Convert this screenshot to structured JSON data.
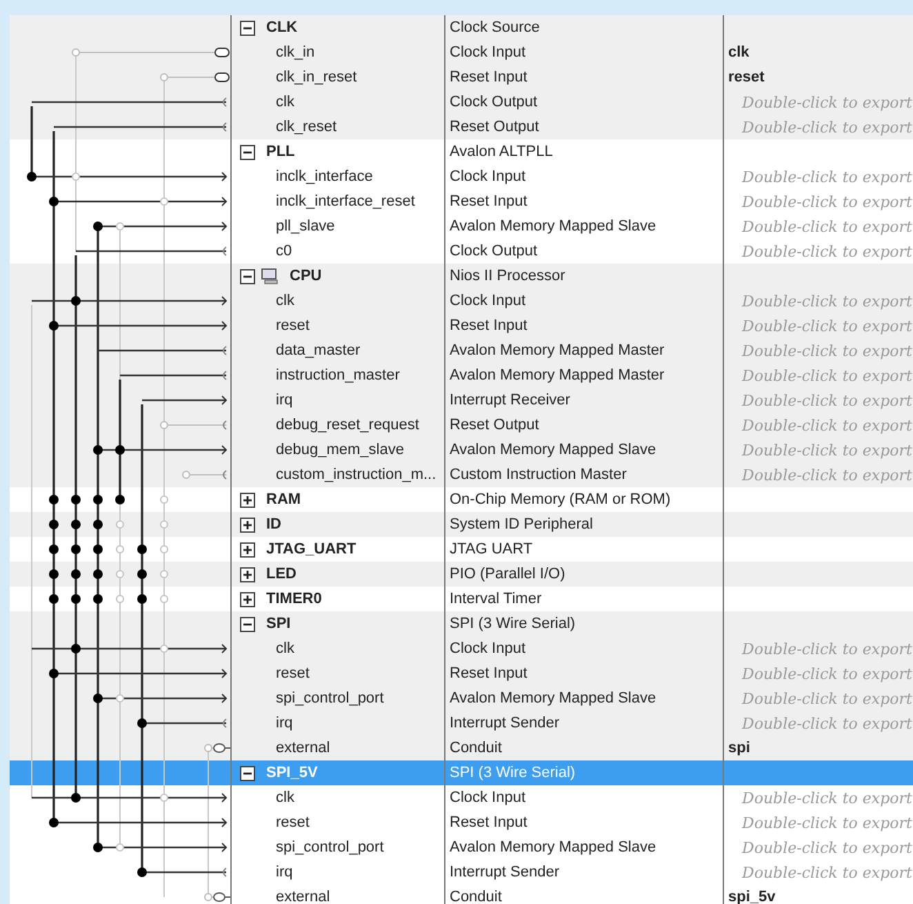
{
  "components": [
    {
      "name": "CLK",
      "description": "Clock Source",
      "kind": "module",
      "expanded": true,
      "selected": false,
      "ports": [
        {
          "name": "clk_in",
          "description": "Clock Input",
          "kind": "export",
          "export": "clk"
        },
        {
          "name": "clk_in_reset",
          "description": "Reset Input",
          "kind": "export",
          "export": "reset"
        },
        {
          "name": "clk",
          "description": "Clock Output",
          "kind": "out",
          "placeholder": "Double-click to export"
        },
        {
          "name": "clk_reset",
          "description": "Reset Output",
          "kind": "out",
          "placeholder": "Double-click to export"
        }
      ]
    },
    {
      "name": "PLL",
      "description": "Avalon ALTPLL",
      "kind": "module",
      "expanded": true,
      "selected": false,
      "ports": [
        {
          "name": "inclk_interface",
          "description": "Clock Input",
          "kind": "in",
          "placeholder": "Double-click to export"
        },
        {
          "name": "inclk_interface_reset",
          "description": "Reset Input",
          "kind": "in",
          "placeholder": "Double-click to export"
        },
        {
          "name": "pll_slave",
          "description": "Avalon Memory Mapped Slave",
          "kind": "in",
          "placeholder": "Double-click to export"
        },
        {
          "name": "c0",
          "description": "Clock Output",
          "kind": "out",
          "placeholder": "Double-click to export"
        }
      ]
    },
    {
      "name": "CPU",
      "description": "Nios II Processor",
      "kind": "processor",
      "expanded": true,
      "selected": false,
      "ports": [
        {
          "name": "clk",
          "description": "Clock Input",
          "kind": "in",
          "placeholder": "Double-click to export"
        },
        {
          "name": "reset",
          "description": "Reset Input",
          "kind": "in",
          "placeholder": "Double-click to export"
        },
        {
          "name": "data_master",
          "description": "Avalon Memory Mapped Master",
          "kind": "out",
          "placeholder": "Double-click to export"
        },
        {
          "name": "instruction_master",
          "description": "Avalon Memory Mapped Master",
          "kind": "out",
          "placeholder": "Double-click to export"
        },
        {
          "name": "irq",
          "description": "Interrupt Receiver",
          "kind": "in",
          "placeholder": "Double-click to export"
        },
        {
          "name": "debug_reset_request",
          "description": "Reset Output",
          "kind": "out",
          "placeholder": "Double-click to export"
        },
        {
          "name": "debug_mem_slave",
          "description": "Avalon Memory Mapped Slave",
          "kind": "in",
          "placeholder": "Double-click to export"
        },
        {
          "name": "custom_instruction_m...",
          "description": "Custom Instruction Master",
          "kind": "out",
          "placeholder": "Double-click to export"
        }
      ]
    },
    {
      "name": "RAM",
      "description": "On-Chip Memory (RAM or ROM)",
      "kind": "module",
      "expanded": false,
      "selected": false
    },
    {
      "name": "ID",
      "description": "System ID Peripheral",
      "kind": "module",
      "expanded": false,
      "selected": false
    },
    {
      "name": "JTAG_UART",
      "description": "JTAG UART",
      "kind": "module",
      "expanded": false,
      "selected": false
    },
    {
      "name": "LED",
      "description": "PIO (Parallel I/O)",
      "kind": "module",
      "expanded": false,
      "selected": false
    },
    {
      "name": "TIMER0",
      "description": "Interval Timer",
      "kind": "module",
      "expanded": false,
      "selected": false
    },
    {
      "name": "SPI",
      "description": "SPI (3 Wire Serial)",
      "kind": "module",
      "expanded": true,
      "selected": false,
      "ports": [
        {
          "name": "clk",
          "description": "Clock Input",
          "kind": "in",
          "placeholder": "Double-click to export"
        },
        {
          "name": "reset",
          "description": "Reset Input",
          "kind": "in",
          "placeholder": "Double-click to export"
        },
        {
          "name": "spi_control_port",
          "description": "Avalon Memory Mapped Slave",
          "kind": "in",
          "placeholder": "Double-click to export"
        },
        {
          "name": "irq",
          "description": "Interrupt Sender",
          "kind": "out",
          "placeholder": "Double-click to export"
        },
        {
          "name": "external",
          "description": "Conduit",
          "kind": "conduit",
          "export": "spi"
        }
      ]
    },
    {
      "name": "SPI_5V",
      "description": "SPI (3 Wire Serial)",
      "kind": "module",
      "expanded": true,
      "selected": true,
      "ports": [
        {
          "name": "clk",
          "description": "Clock Input",
          "kind": "in",
          "placeholder": "Double-click to export"
        },
        {
          "name": "reset",
          "description": "Reset Input",
          "kind": "in",
          "placeholder": "Double-click to export"
        },
        {
          "name": "spi_control_port",
          "description": "Avalon Memory Mapped Slave",
          "kind": "in",
          "placeholder": "Double-click to export"
        },
        {
          "name": "irq",
          "description": "Interrupt Sender",
          "kind": "out",
          "placeholder": "Double-click to export"
        },
        {
          "name": "external",
          "description": "Conduit",
          "kind": "conduit",
          "export": "spi_5v"
        }
      ]
    }
  ]
}
